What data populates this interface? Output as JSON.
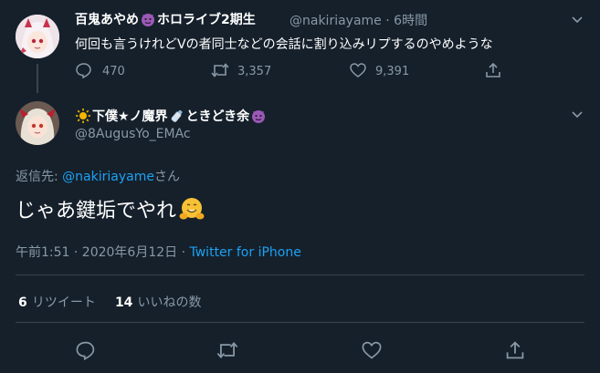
{
  "quoted_tweet": {
    "author_name": "百鬼あやめ",
    "author_name_tail": "ホロライブ2期生",
    "handle": "@nakiriayame",
    "separator": "·",
    "time": "6時間",
    "text": "何回も言うけれどVの者同士などの会話に割り込みリプするのやめような",
    "stats": {
      "replies": "470",
      "retweets": "3,357",
      "likes": "9,391"
    }
  },
  "main_tweet": {
    "author_name_a": "下僕★ノ魔界",
    "author_name_b": "ときどき余",
    "handle": "@8AugusYo_EMAc",
    "reply_prefix": "返信先: ",
    "reply_to": "@nakiriayame",
    "reply_suffix": "さん",
    "text": "じゃあ鍵垢でやれ",
    "timestamp": "午前1:51 · 2020年6月12日 · ",
    "source": "Twitter for iPhone",
    "retweet_count": "6",
    "retweet_label": "リツイート",
    "like_count": "14",
    "like_label": "いいねの数"
  },
  "icons": [
    "devil-emoji-icon",
    "sun-emoji-icon",
    "bottle-emoji-icon",
    "hugging-emoji-icon",
    "chevron-down-icon",
    "reply-icon",
    "retweet-icon",
    "like-icon",
    "share-icon"
  ],
  "colors": {
    "background": "#15202b",
    "text": "#ffffff",
    "muted": "#8899a6",
    "link": "#1da1f2",
    "divider": "#38444d"
  }
}
